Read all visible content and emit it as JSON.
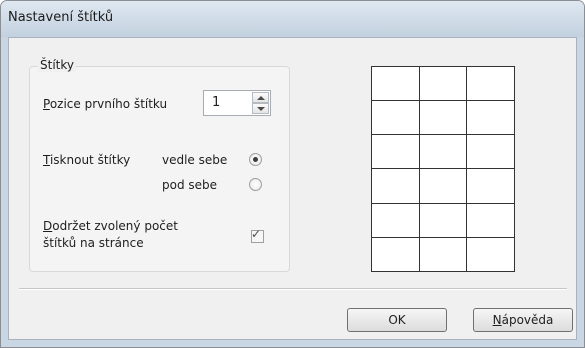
{
  "window": {
    "title": "Nastavení štítků"
  },
  "group": {
    "title": "Štítky"
  },
  "first_label": {
    "label": "Pozice prvního štítku",
    "value": "1"
  },
  "print_labels": {
    "label": "Tisknout štítky",
    "options": [
      {
        "label": "vedle sebe",
        "selected": true
      },
      {
        "label": "pod sebe",
        "selected": false
      }
    ]
  },
  "keep_count": {
    "label_line1": "Dodržet zvolený počet",
    "label_line2": "štítků na stránce",
    "checked": true
  },
  "preview": {
    "rows": 6,
    "cols": 3
  },
  "buttons": {
    "ok": "OK",
    "help": "Nápověda"
  }
}
